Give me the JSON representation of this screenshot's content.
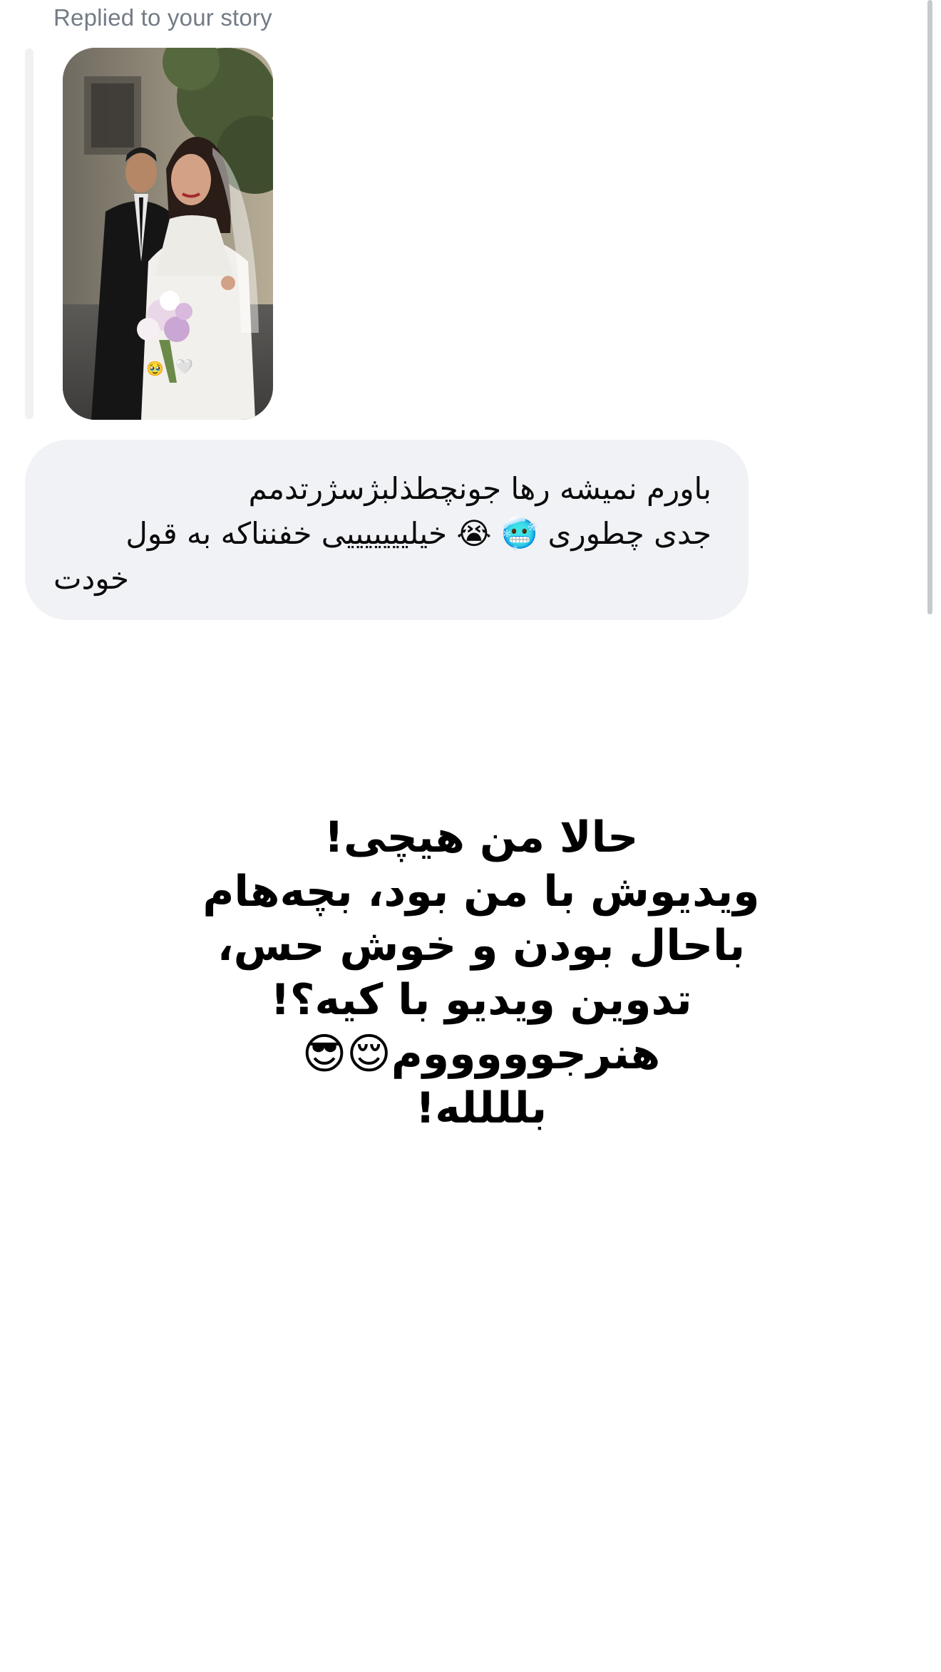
{
  "reply": {
    "label": "Replied to your story"
  },
  "story_thumbnail": {
    "description_icon": "story-photo-icon",
    "stickers": [
      "🥹",
      "🤍"
    ]
  },
  "message": {
    "line1": "باورم نمیشه رها جونچطذلبژسژرتدمم",
    "line2": "جدی چطوری 🥶 😭 خیلیییییییی خفنناکه به قول",
    "line3": "خودت"
  },
  "story": {
    "line1": "حالا من هیچی!",
    "line2": "ویدیوش با من بود، بچه‌هام",
    "line3": "باحال بودن و خوش حس،",
    "line4": "تدوین ویدیو با کیه؟!",
    "line5": "هنرجوووووم😌😎",
    "line6": "بلللله!"
  },
  "colors": {
    "bubble_bg": "#f1f2f5",
    "label": "#737b86",
    "text": "#0b0b0b"
  }
}
